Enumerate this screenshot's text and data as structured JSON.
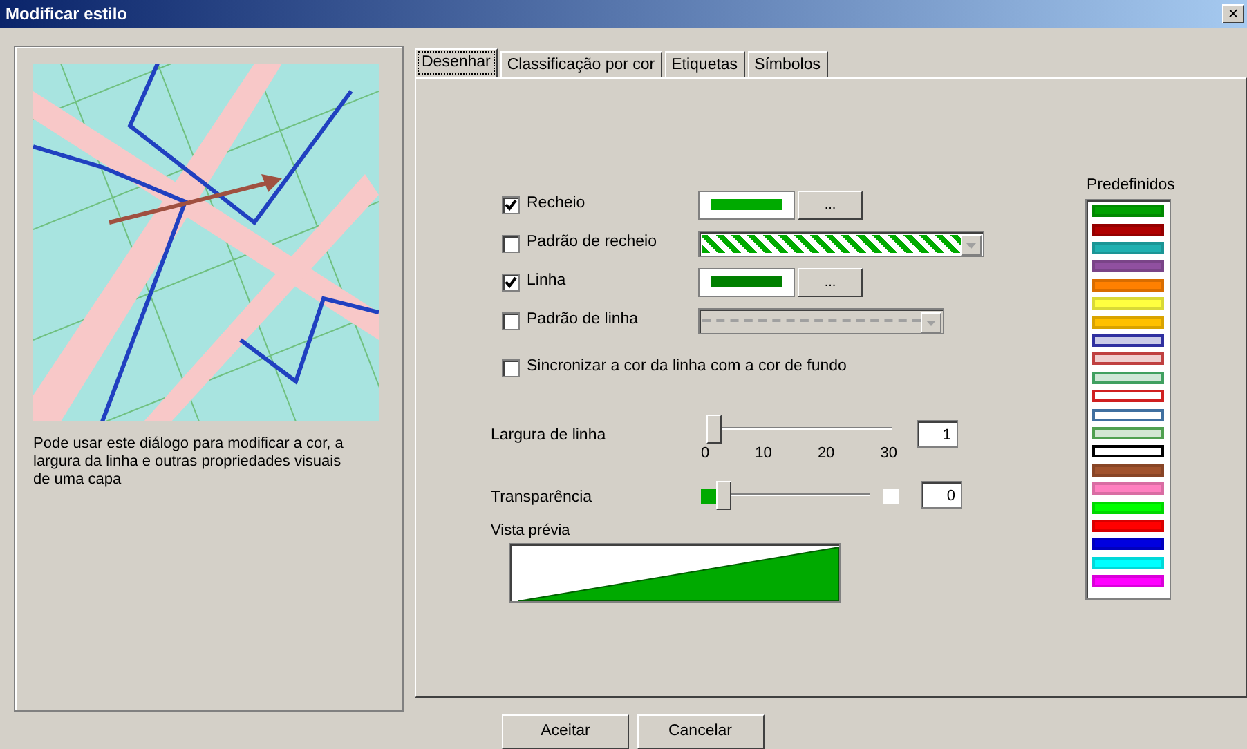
{
  "window": {
    "title": "Modificar estilo",
    "close": "×"
  },
  "description": "Pode usar este diálogo para modificar a cor, a largura da linha e outras propriedades visuais de uma capa",
  "tabs": [
    {
      "label": "Desenhar",
      "selected": true
    },
    {
      "label": "Classificação por cor",
      "selected": false
    },
    {
      "label": "Etiquetas",
      "selected": false
    },
    {
      "label": "Símbolos",
      "selected": false
    }
  ],
  "options": [
    {
      "kind": "color",
      "label": "Recheio",
      "checked": true,
      "color": "#00aa00",
      "button": "..."
    },
    {
      "kind": "fill_pattern",
      "label": "Padrão de recheio",
      "checked": false
    },
    {
      "kind": "color",
      "label": "Linha",
      "checked": true,
      "color": "#008000",
      "button": "..."
    },
    {
      "kind": "line_pattern",
      "label": "Padrão de linha",
      "checked": false
    },
    {
      "kind": "plain",
      "label": "Sincronizar a cor da linha com a cor de fundo",
      "checked": false
    }
  ],
  "sliders": [
    {
      "kind": "ticks",
      "label": "Largura de linha",
      "level": 0.033,
      "ticks": [
        "0",
        "10",
        "20",
        "30"
      ],
      "value": "1"
    },
    {
      "kind": "transparency",
      "label": "Transparência",
      "level": 0,
      "value": "0"
    }
  ],
  "preview": {
    "label": "Vista prévia",
    "color": "#00aa00"
  },
  "presets": {
    "label": "Predefinidos",
    "items": [
      {
        "kind": "solid",
        "color": "#00a000"
      },
      {
        "kind": "solid",
        "color": "#b00000"
      },
      {
        "kind": "solid",
        "color": "#20b0b0"
      },
      {
        "kind": "solid",
        "color": "#9050a0"
      },
      {
        "kind": "solid",
        "color": "#ff8000"
      },
      {
        "kind": "solid",
        "color": "#ffff40"
      },
      {
        "kind": "solid",
        "color": "#ffc000"
      },
      {
        "kind": "tinted",
        "color": "#3030a0"
      },
      {
        "kind": "tinted",
        "color": "#c04040"
      },
      {
        "kind": "tinted",
        "color": "#40a060"
      },
      {
        "kind": "outline",
        "color": "#d02020"
      },
      {
        "kind": "outline",
        "color": "#4070a0"
      },
      {
        "kind": "tinted",
        "color": "#50a050"
      },
      {
        "kind": "outline",
        "color": "#000000"
      },
      {
        "kind": "solid",
        "color": "#a0522d"
      },
      {
        "kind": "solid",
        "color": "#ff80c0"
      },
      {
        "kind": "solid",
        "color": "#00ff00"
      },
      {
        "kind": "solid",
        "color": "#ff0000"
      },
      {
        "kind": "solid",
        "color": "#0000e0"
      },
      {
        "kind": "solid",
        "color": "#00ffff"
      },
      {
        "kind": "solid",
        "color": "#ff00ff"
      }
    ]
  },
  "buttons": [
    "Aceitar",
    "Cancelar"
  ]
}
